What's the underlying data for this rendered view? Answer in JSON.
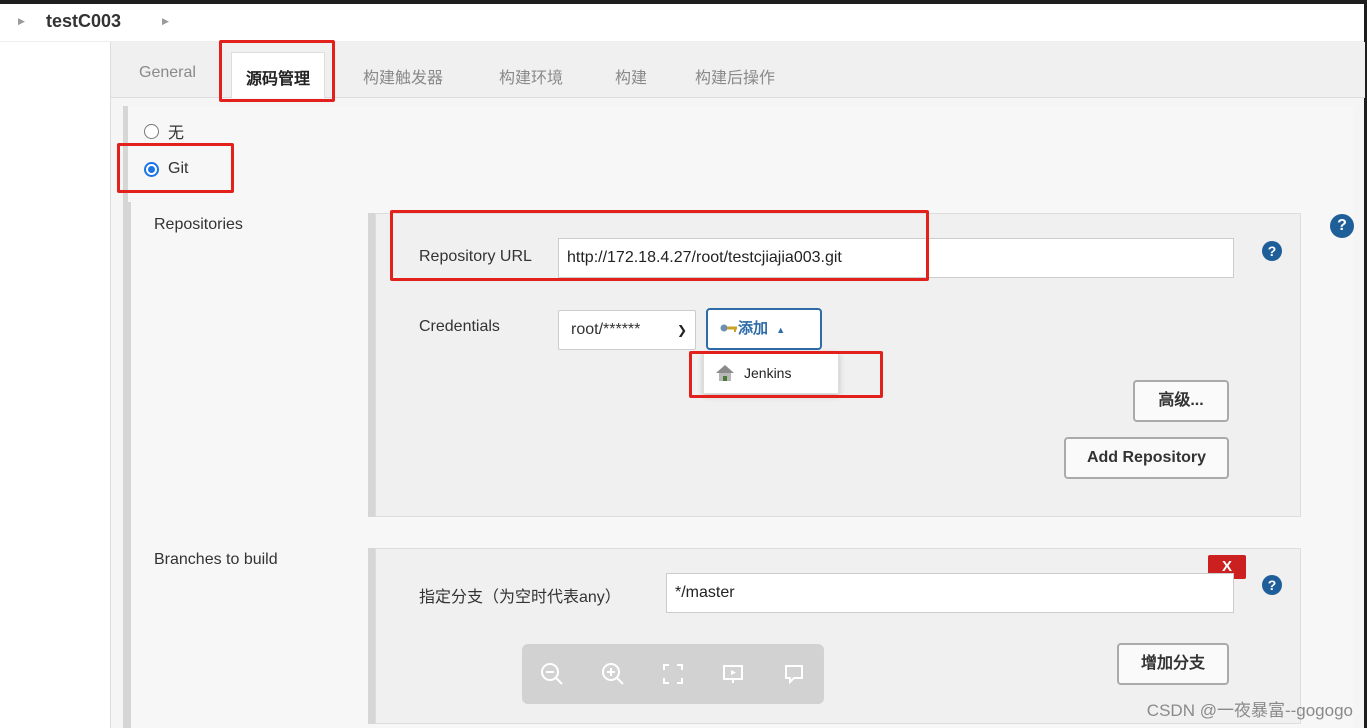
{
  "breadcrumb": {
    "title": "testC003"
  },
  "tabs": [
    {
      "label": "General"
    },
    {
      "label": "源码管理"
    },
    {
      "label": "构建触发器"
    },
    {
      "label": "构建环境"
    },
    {
      "label": "构建"
    },
    {
      "label": "构建后操作"
    }
  ],
  "scm": {
    "option_none": "无",
    "option_git": "Git",
    "selected": "Git"
  },
  "repositories": {
    "section_label": "Repositories",
    "url_label": "Repository URL",
    "url_value": "http://172.18.4.27/root/testcjiajia003.git",
    "credentials_label": "Credentials",
    "credentials_value": "root/******",
    "add_label": "添加",
    "dropdown_item": "Jenkins",
    "advanced_label": "高级...",
    "add_repository_label": "Add Repository"
  },
  "branches": {
    "section_label": "Branches to build",
    "branch_label": "指定分支（为空时代表any）",
    "branch_value": "*/master",
    "delete_label": "X",
    "add_branch_label": "增加分支"
  },
  "help_label": "?",
  "watermark": "CSDN @一夜暴富--gogogo",
  "colors": {
    "highlight_red": "#e3211c",
    "accent_blue": "#1f5f99",
    "delete_red": "#cc1f1f"
  }
}
